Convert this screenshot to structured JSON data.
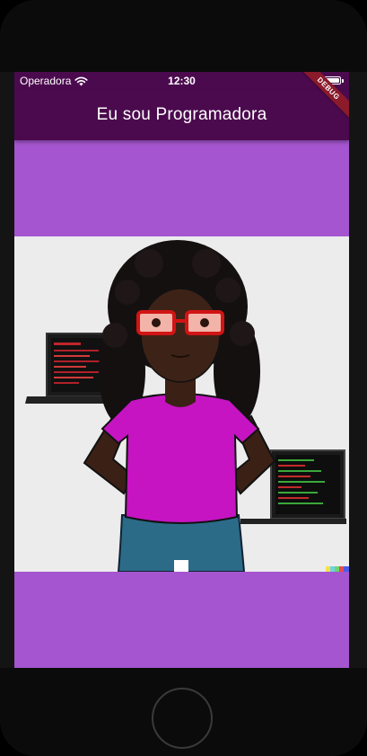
{
  "status_bar": {
    "carrier": "Operadora",
    "time": "12:30",
    "wifi_icon": "wifi-icon",
    "battery_icon": "battery-icon",
    "battery_level": 1.0
  },
  "app_bar": {
    "title": "Eu sou Programadora",
    "background_color": "#4b0a4e"
  },
  "debug_banner": "DEBUG",
  "body": {
    "background_color": "#a455cf",
    "image_subject": "illustration-programmer-woman"
  }
}
